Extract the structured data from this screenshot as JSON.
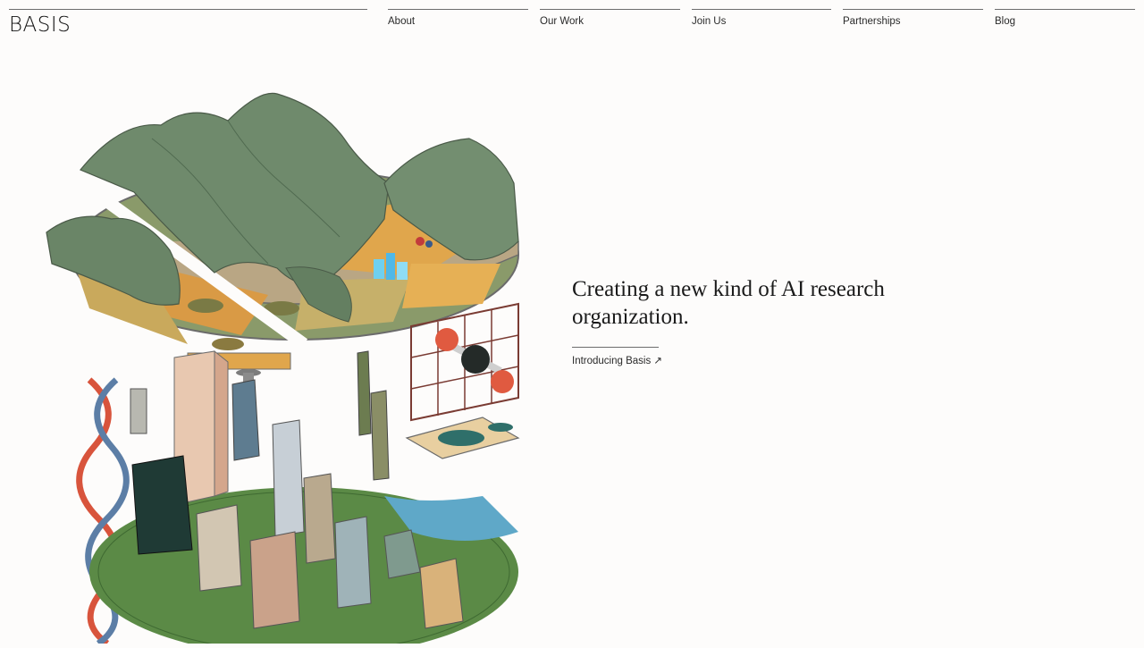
{
  "brand": {
    "name": "BASIS"
  },
  "nav": {
    "items": [
      {
        "label": "About"
      },
      {
        "label": "Our Work"
      },
      {
        "label": "Join Us"
      },
      {
        "label": "Partnerships"
      },
      {
        "label": "Blog"
      }
    ]
  },
  "hero": {
    "headline": "Creating a new kind of AI research organization.",
    "cta_label": "Introducing Basis ↗"
  },
  "colors": {
    "background": "#fdfcfb",
    "text": "#1d1d1b",
    "rule": "#6d6d6d",
    "mountain_green": "#6f8a6c",
    "field_orange": "#e0a64c",
    "accent_red": "#d8543c"
  },
  "icons": [
    "external-arrow-icon"
  ]
}
